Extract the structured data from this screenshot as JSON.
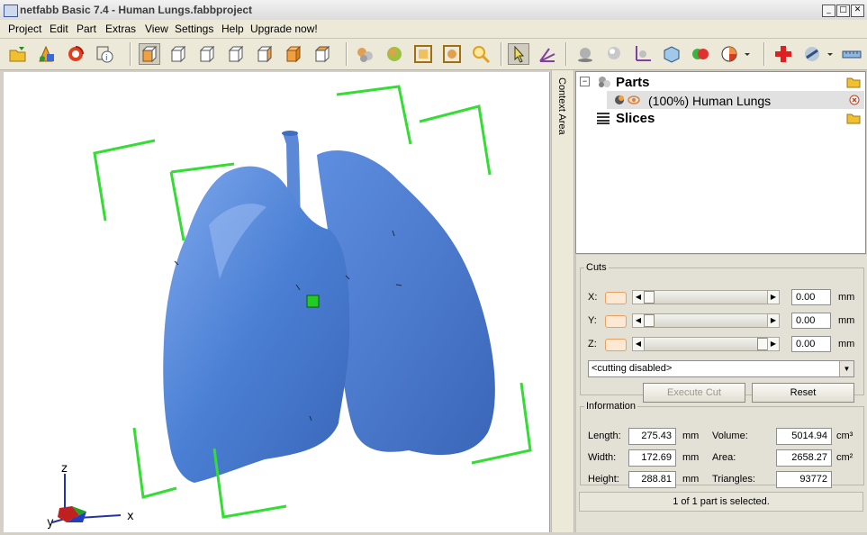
{
  "window": {
    "title": "netfabb Basic 7.4 - Human Lungs.fabbproject",
    "controls": [
      "_",
      "□",
      "✕"
    ]
  },
  "menu": [
    "Project",
    "Edit",
    "Part",
    "Extras",
    "View",
    "Settings",
    "Help",
    "Upgrade now!"
  ],
  "toolbar": {
    "buttons": [
      "open-icon",
      "add-part-icon",
      "repair-icon",
      "part-info-icon",
      "view-default-icon",
      "view-front-icon",
      "view-back-icon",
      "view-left-icon",
      "view-right-icon",
      "view-top-icon",
      "view-bottom-icon",
      "show-parts-icon",
      "show-mesh-icon",
      "zoom-selection-icon",
      "zoom-parts-icon",
      "zoom-icon",
      "select-icon",
      "move-icon",
      "ambient-icon",
      "lighting-icon",
      "axes-icon",
      "cube-icon",
      "boolean-icon",
      "pie-icon",
      "add-icon",
      "render-icon",
      "ruler-icon"
    ]
  },
  "context_area": {
    "label": "Context Area"
  },
  "tree": {
    "parts_label": "Parts",
    "part_name": "(100%) Human Lungs",
    "slices_label": "Slices"
  },
  "cuts": {
    "legend": "Cuts",
    "rows": [
      {
        "axis": "X:",
        "value": "0.00",
        "unit": "mm",
        "position": 0.0
      },
      {
        "axis": "Y:",
        "value": "0.00",
        "unit": "mm",
        "position": 0.0
      },
      {
        "axis": "Z:",
        "value": "0.00",
        "unit": "mm",
        "position": 1.0
      }
    ],
    "mode": "<cutting disabled>",
    "execute_label": "Execute Cut",
    "reset_label": "Reset"
  },
  "information": {
    "legend": "Information",
    "length_label": "Length:",
    "length_value": "275.43",
    "length_unit": "mm",
    "width_label": "Width:",
    "width_value": "172.69",
    "width_unit": "mm",
    "height_label": "Height:",
    "height_value": "288.81",
    "height_unit": "mm",
    "volume_label": "Volume:",
    "volume_value": "5014.94",
    "volume_unit": "cm³",
    "area_label": "Area:",
    "area_value": "2658.27",
    "area_unit": "cm²",
    "triangles_label": "Triangles:",
    "triangles_value": "93772"
  },
  "status": "1 of 1 part is selected.",
  "axes": {
    "z": "z",
    "y": "y",
    "x": "x"
  },
  "colors": {
    "model": "#4a7fd4",
    "bbox": "#33dd33",
    "selection": "#22cc22"
  }
}
